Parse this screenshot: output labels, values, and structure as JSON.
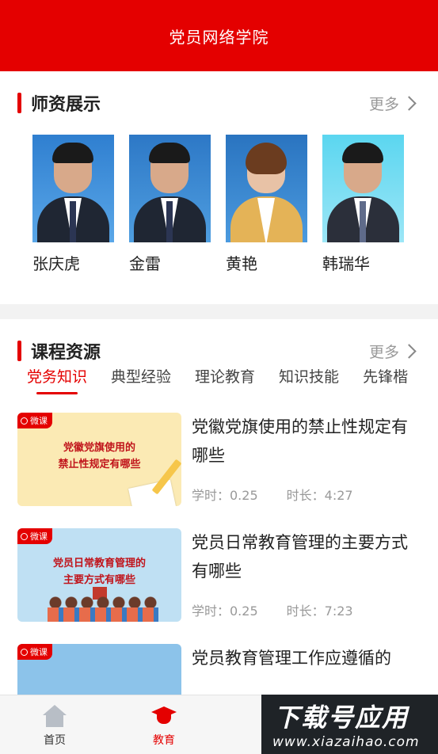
{
  "header": {
    "title": "党员网络学院"
  },
  "teachers_section": {
    "title": "师资展示",
    "more_label": "更多",
    "teachers": [
      {
        "name": "张庆虎"
      },
      {
        "name": "金雷"
      },
      {
        "name": "黄艳"
      },
      {
        "name": "韩瑞华"
      }
    ]
  },
  "courses_section": {
    "title": "课程资源",
    "more_label": "更多",
    "tabs": [
      {
        "label": "党务知识",
        "active": true
      },
      {
        "label": "典型经验"
      },
      {
        "label": "理论教育"
      },
      {
        "label": "知识技能"
      },
      {
        "label": "先锋楷"
      }
    ],
    "courses": [
      {
        "badge": "微课",
        "thumb_text": [
          "党徽党旗使用的",
          "禁止性规定有哪些"
        ],
        "title": "党徽党旗使用的禁止性规定有哪些",
        "hours": "学时：0.25",
        "duration": "时长：4:27"
      },
      {
        "badge": "微课",
        "thumb_text": [
          "党员日常教育管理的",
          "主要方式有哪些"
        ],
        "title": "党员日常教育管理的主要方式有哪些",
        "hours": "学时：0.25",
        "duration": "时长：7:23"
      },
      {
        "badge": "微课",
        "thumb_text": [],
        "title": "党员教育管理工作应遵循的"
      }
    ]
  },
  "tabbar": {
    "items": [
      {
        "label": "首页",
        "icon": "home-icon"
      },
      {
        "label": "教育",
        "icon": "graduation-cap-icon",
        "active": true
      }
    ]
  },
  "watermark": {
    "big": "下载号应用",
    "small": "www.xiazaihao.com"
  },
  "colors": {
    "brand": "#e40000"
  }
}
